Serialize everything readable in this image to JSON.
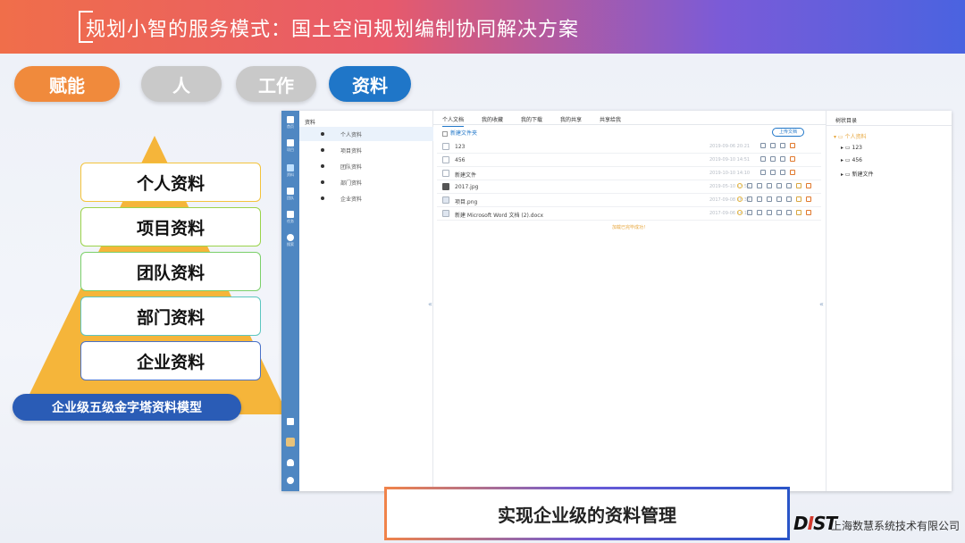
{
  "header": {
    "title": "规划小智的服务模式：国土空间规划编制协同解决方案"
  },
  "pills": [
    {
      "label": "赋能",
      "color": "#f08a3c"
    },
    {
      "label": "人",
      "color": "#c9c9c9"
    },
    {
      "label": "工作",
      "color": "#c9c9c9"
    },
    {
      "label": "资料",
      "color": "#1f76c8"
    }
  ],
  "pyramid": {
    "color": "#f5b53a",
    "layers": [
      "个人资料",
      "项目资料",
      "团队资料",
      "部门资料",
      "企业资料"
    ],
    "layer_border_colors": [
      "#f3c33b",
      "#9ad34a",
      "#7bd06a",
      "#5cc6c0",
      "#4a72c8"
    ],
    "model_label": "企业级五级金字塔资料模型"
  },
  "app": {
    "rail": [
      {
        "icon": "home-icon",
        "label": "首页"
      },
      {
        "icon": "grid-icon",
        "label": "项目"
      },
      {
        "icon": "folder-icon",
        "label": "资料"
      },
      {
        "icon": "team-icon",
        "label": "团队"
      },
      {
        "icon": "task-icon",
        "label": "任务"
      },
      {
        "icon": "search-icon",
        "label": "搜索"
      }
    ],
    "rail_bottom": [
      "org-icon",
      "avatar",
      "bell-icon",
      "help-icon"
    ],
    "tree": {
      "header": "资料",
      "items": [
        "个人资料",
        "项目资料",
        "团队资料",
        "部门资料",
        "企业资料"
      ],
      "selected": 0
    },
    "tabs": [
      "个人文档",
      "我的收藏",
      "我的下载",
      "我的共享",
      "共享给我"
    ],
    "active_tab": 0,
    "new_folder": "新建文件夹",
    "upload": "上传文档",
    "files": [
      {
        "name": "123",
        "date": "2019-09-06 20:21",
        "type": "folder"
      },
      {
        "name": "456",
        "date": "2019-09-10 14:51",
        "type": "folder"
      },
      {
        "name": "新建文件",
        "date": "2019-10-10 14:10",
        "type": "folder"
      },
      {
        "name": "2017.jpg",
        "date": "2019-05-10 13:55",
        "type": "img"
      },
      {
        "name": "项目.png",
        "date": "2017-09-08 16:38",
        "type": "doc"
      },
      {
        "name": "新建 Microsoft Word 文档 (2).docx",
        "date": "2017-09-06 14:15",
        "type": "doc"
      }
    ],
    "loaded_text": "加载已完毕成功！",
    "side": {
      "header": "树状目录",
      "root": "个人资料",
      "children": [
        "123",
        "456",
        "新建文件"
      ]
    }
  },
  "caption": "实现企业级的资料管理",
  "logo": {
    "brand": "DIST"
  },
  "company": "上海数慧系统技术有限公司"
}
